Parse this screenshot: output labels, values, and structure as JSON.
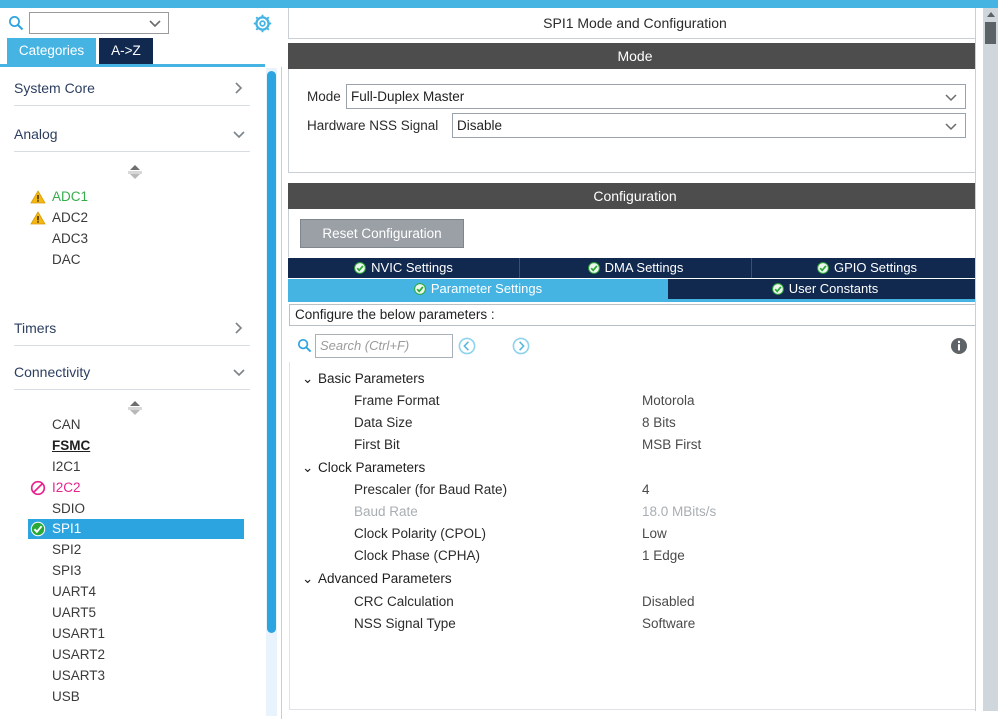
{
  "colors": {
    "accent_blue": "#45b4e3",
    "tab_navy": "#11284f",
    "band_gray": "#4d4d4d",
    "select_blue": "#2ca4e0",
    "warn_yellow": "#f5b712",
    "forbid_pink": "#e8238c",
    "ok_green": "#36ad4a"
  },
  "sidebar": {
    "search": {
      "value": "",
      "placeholder": ""
    },
    "search_icon": "search-icon",
    "settings_icon": "gear-icon",
    "tabs": [
      {
        "label": "Categories",
        "active": true
      },
      {
        "label": "A->Z",
        "active": false
      }
    ],
    "categories": [
      {
        "label": "System Core",
        "expanded": false
      },
      {
        "label": "Analog",
        "expanded": true
      },
      {
        "label": "Timers",
        "expanded": false
      },
      {
        "label": "Connectivity",
        "expanded": true
      }
    ],
    "analog_items": [
      {
        "label": "ADC1",
        "state": "warning",
        "color": "green"
      },
      {
        "label": "ADC2",
        "state": "warning",
        "color": "default"
      },
      {
        "label": "ADC3",
        "state": "none",
        "color": "default"
      },
      {
        "label": "DAC",
        "state": "none",
        "color": "default"
      }
    ],
    "connectivity_items": [
      {
        "label": "CAN",
        "state": "none",
        "color": "default"
      },
      {
        "label": "FSMC",
        "state": "none",
        "color": "bold"
      },
      {
        "label": "I2C1",
        "state": "none",
        "color": "default"
      },
      {
        "label": "I2C2",
        "state": "forbidden",
        "color": "pink"
      },
      {
        "label": "SDIO",
        "state": "none",
        "color": "default"
      },
      {
        "label": "SPI1",
        "state": "checked",
        "color": "default",
        "selected": true
      },
      {
        "label": "SPI2",
        "state": "none",
        "color": "default"
      },
      {
        "label": "SPI3",
        "state": "none",
        "color": "default"
      },
      {
        "label": "UART4",
        "state": "none",
        "color": "default"
      },
      {
        "label": "UART5",
        "state": "none",
        "color": "default"
      },
      {
        "label": "USART1",
        "state": "none",
        "color": "default"
      },
      {
        "label": "USART2",
        "state": "none",
        "color": "default"
      },
      {
        "label": "USART3",
        "state": "none",
        "color": "default"
      },
      {
        "label": "USB",
        "state": "none",
        "color": "default"
      }
    ]
  },
  "panel": {
    "title": "SPI1 Mode and Configuration",
    "mode_band": "Mode",
    "config_band": "Configuration",
    "mode_fields": [
      {
        "label": "Mode",
        "value": "Full-Duplex Master"
      },
      {
        "label": "Hardware NSS Signal",
        "value": "Disable"
      }
    ],
    "reset_button": "Reset Configuration",
    "tabs_row1": [
      {
        "label": "NVIC Settings",
        "active": false
      },
      {
        "label": "DMA Settings",
        "active": false
      },
      {
        "label": "GPIO Settings",
        "active": false
      }
    ],
    "tabs_row2": [
      {
        "label": "Parameter Settings",
        "active": true
      },
      {
        "label": "User Constants",
        "active": false
      }
    ],
    "configure_hint": "Configure the below parameters :",
    "search": {
      "value": "",
      "placeholder": "Search (Ctrl+F)"
    },
    "nav_prev_icon": "prev-circle-icon",
    "nav_next_icon": "next-circle-icon",
    "info_icon": "info-icon",
    "groups": [
      {
        "label": "Basic Parameters",
        "rows": [
          {
            "name": "Frame Format",
            "value": "Motorola",
            "disabled": false
          },
          {
            "name": "Data Size",
            "value": "8 Bits",
            "disabled": false
          },
          {
            "name": "First Bit",
            "value": "MSB First",
            "disabled": false
          }
        ]
      },
      {
        "label": "Clock Parameters",
        "rows": [
          {
            "name": "Prescaler (for Baud Rate)",
            "value": "4",
            "disabled": false
          },
          {
            "name": "Baud Rate",
            "value": "18.0 MBits/s",
            "disabled": true
          },
          {
            "name": "Clock Polarity (CPOL)",
            "value": "Low",
            "disabled": false
          },
          {
            "name": "Clock Phase (CPHA)",
            "value": "1 Edge",
            "disabled": false
          }
        ]
      },
      {
        "label": "Advanced Parameters",
        "rows": [
          {
            "name": "CRC Calculation",
            "value": "Disabled",
            "disabled": false
          },
          {
            "name": "NSS Signal Type",
            "value": "Software",
            "disabled": false
          }
        ]
      }
    ]
  }
}
